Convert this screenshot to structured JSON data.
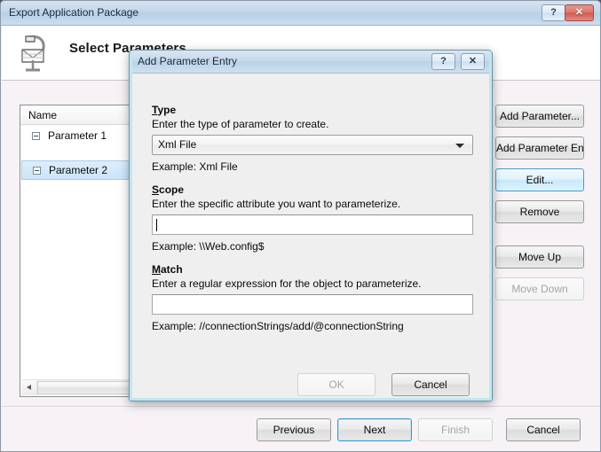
{
  "main_window": {
    "title": "Export Application Package",
    "help_button": "?",
    "close_button": "✕",
    "wizard_heading": "Select Parameters",
    "wizard_icon": "export-package-icon"
  },
  "param_list": {
    "column_header": "Name",
    "rows": [
      {
        "label": "Parameter 1",
        "selected": false,
        "expander": "collapse-box"
      },
      {
        "label": "Parameter 2",
        "selected": true,
        "expander": "collapse-box"
      }
    ],
    "hscroll_left_arrow": "◀"
  },
  "side_buttons": [
    {
      "label": "Add Parameter...",
      "state": "normal"
    },
    {
      "label": "Add Parameter Entry...",
      "state": "normal"
    },
    {
      "label": "Edit...",
      "state": "hover"
    },
    {
      "label": "Remove",
      "state": "normal"
    },
    {
      "label": "Move Up",
      "state": "normal"
    },
    {
      "label": "Move Down",
      "state": "disabled"
    }
  ],
  "footer_buttons": [
    {
      "label": "Previous",
      "state": "normal"
    },
    {
      "label": "Next",
      "state": "default"
    },
    {
      "label": "Finish",
      "state": "disabled"
    },
    {
      "label": "Cancel",
      "state": "normal"
    }
  ],
  "dialog": {
    "title": "Add Parameter Entry",
    "help_button": "?",
    "close_button": "✕",
    "fields": {
      "type": {
        "label_accesskey": "T",
        "label_rest": "ype",
        "description": "Enter the type of parameter to create.",
        "selected_value": "Xml File",
        "example": "Example: Xml File",
        "options": [
          "Xml File"
        ]
      },
      "scope": {
        "label_accesskey": "S",
        "label_rest": "cope",
        "description": "Enter the specific attribute you want to parameterize.",
        "value": "",
        "example": "Example: \\\\Web.config$",
        "focused": true
      },
      "match": {
        "label_accesskey": "M",
        "label_rest": "atch",
        "description": "Enter a regular expression for the object to parameterize.",
        "value": "",
        "example": "Example: //connectionStrings/add/@connectionString",
        "focused": false
      }
    },
    "buttons": [
      {
        "label": "OK",
        "state": "disabled"
      },
      {
        "label": "Cancel",
        "state": "normal"
      }
    ]
  },
  "colors": {
    "titlebar_blue": "#c3d7ea",
    "close_red": "#cf5b50",
    "dialog_border_cyan": "#bfe7f2",
    "selection_blue": "#cbe4fa",
    "hover_blue": "#c9e9fb",
    "window_bg": "#f6f2f5"
  }
}
